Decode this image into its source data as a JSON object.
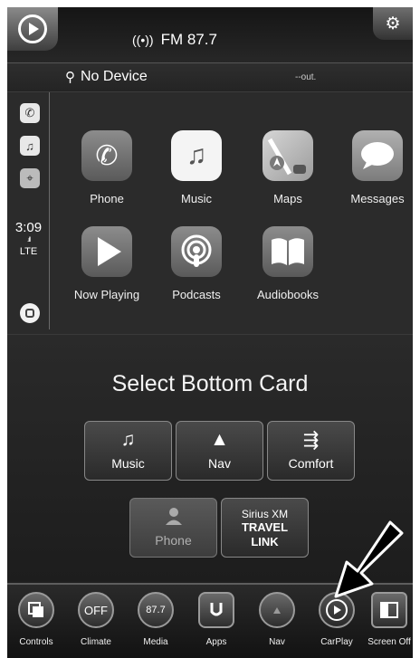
{
  "header": {
    "radio_icon": "radio-signal-icon",
    "radio_station": "FM 87.7",
    "settings_icon": "gear-icon"
  },
  "status": {
    "device": "No Device",
    "usb_icon": "usb-icon",
    "out_text": "--out."
  },
  "carplay": {
    "sidebar": {
      "icons": [
        "phone-icon",
        "music-icon",
        "maps-icon"
      ],
      "time": "3:09",
      "signal": ".ıll",
      "network": "LTE"
    },
    "apps": [
      {
        "label": "Phone",
        "icon": "phone-icon"
      },
      {
        "label": "Music",
        "icon": "music-icon"
      },
      {
        "label": "Maps",
        "icon": "maps-icon"
      },
      {
        "label": "Messages",
        "icon": "messages-icon"
      },
      {
        "label": "Now Playing",
        "icon": "now-playing-icon"
      },
      {
        "label": "Podcasts",
        "icon": "podcasts-icon"
      },
      {
        "label": "Audiobooks",
        "icon": "audiobooks-icon"
      }
    ]
  },
  "select_card": {
    "title": "Select Bottom Card",
    "cards": [
      {
        "label": "Music",
        "icon": "music-note-icon"
      },
      {
        "label": "Nav",
        "icon": "nav-arrow-icon"
      },
      {
        "label": "Comfort",
        "icon": "seat-fan-icon"
      },
      {
        "label": "Phone",
        "icon": "person-icon"
      }
    ],
    "sxm": {
      "line1": "Sirius XM",
      "line2": "TRAVEL",
      "line3": "LINK"
    }
  },
  "bottom_bar": [
    {
      "label": "Controls",
      "icon": "controls-icon"
    },
    {
      "label": "Climate",
      "icon": "climate-icon",
      "text": "OFF"
    },
    {
      "label": "Media",
      "icon": "media-icon",
      "text": "87.7"
    },
    {
      "label": "Apps",
      "icon": "apps-icon"
    },
    {
      "label": "Nav",
      "icon": "nav-icon"
    },
    {
      "label": "CarPlay",
      "icon": "carplay-icon"
    },
    {
      "label": "Screen Off",
      "icon": "screen-off-icon"
    }
  ],
  "colors": {
    "accent": "#ffffff",
    "background": "#1f1f1f",
    "arrow": "#000000"
  }
}
